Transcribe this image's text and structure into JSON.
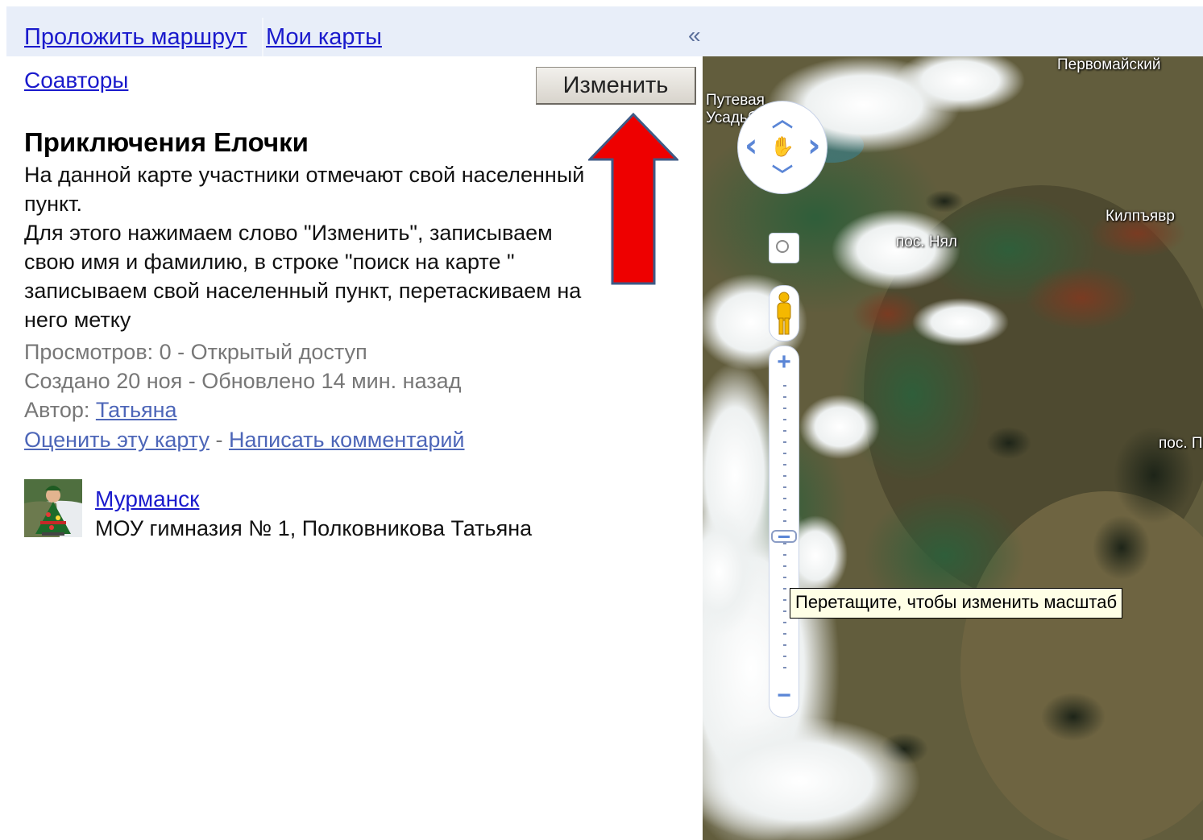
{
  "topbar": {
    "route_link": "Проложить маршрут",
    "my_maps_link": "Мои карты",
    "collapse": "«"
  },
  "panel": {
    "coauthors_link": "Соавторы",
    "edit_button": "Изменить",
    "map_title": "Приключения Елочки",
    "description_lines": [
      "На данной карте участники отмечают свой населенный",
      "пункт.",
      "Для этого нажимаем слово \"Изменить\", записываем",
      "свою имя и фамилию, в строке \"поиск на карте \"",
      "записываем свой населенный пункт, перетаскиваем на",
      "него метку"
    ],
    "views": "Просмотров: 0 - Открытый доступ",
    "created": "Создано 20 ноя - Обновлено 14 мин. назад",
    "author_label": "Автор:",
    "author_name": "Татьяна",
    "rate_link": "Оценить эту карту",
    "rate_separator": " - ",
    "comment_link": "Написать комментарий",
    "entry": {
      "title": "Мурманск",
      "description": "МОУ гимназия № 1, Полковникова Татьяна"
    }
  },
  "map": {
    "labels": {
      "pervomaisky": "Первомайский",
      "putevaya": "Путевая",
      "usadba": "Усадьба",
      "kilpyavr": "Килпъявр",
      "nyal": "пос. Нял",
      "pos_edge": "пос. П"
    },
    "controls": {
      "pan_up": "︿",
      "pan_down": "﹀",
      "pan_left": "‹",
      "pan_right": "›",
      "pan_hand": "✋",
      "zoom_in": "+",
      "zoom_out": "−"
    },
    "tooltip": "Перетащите, чтобы изменить масштаб"
  }
}
